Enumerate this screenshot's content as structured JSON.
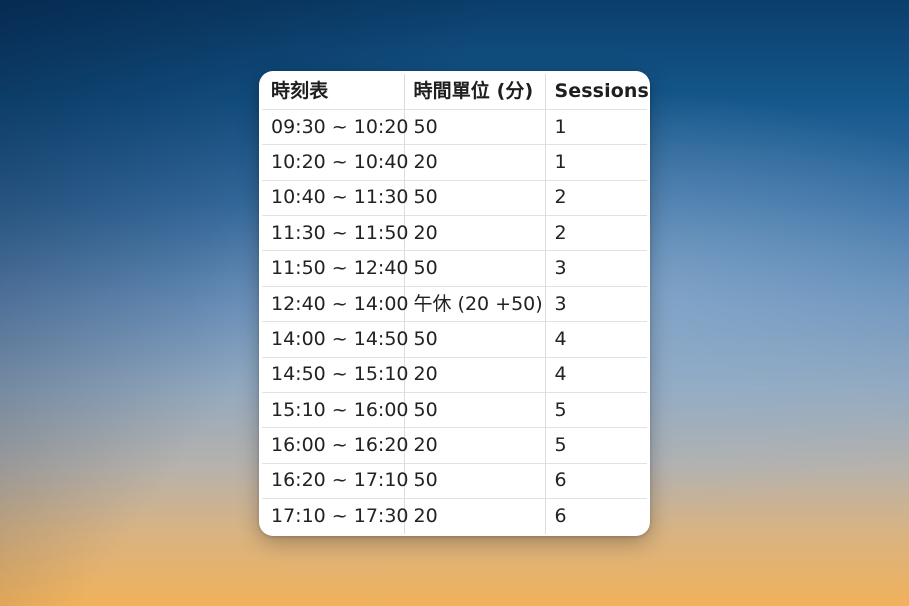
{
  "table": {
    "headers": [
      "時刻表",
      "時間單位 (分)",
      "Sessions"
    ],
    "rows": [
      [
        "09:30 ~ 10:20",
        "50",
        "1"
      ],
      [
        "10:20 ~ 10:40",
        "20",
        "1"
      ],
      [
        "10:40 ~ 11:30",
        "50",
        "2"
      ],
      [
        "11:30 ~ 11:50",
        "20",
        "2"
      ],
      [
        "11:50 ~ 12:40",
        "50",
        "3"
      ],
      [
        "12:40 ~ 14:00",
        "午休 (20 +50)",
        "3"
      ],
      [
        "14:00 ~ 14:50",
        "50",
        "4"
      ],
      [
        "14:50 ~ 15:10",
        "20",
        "4"
      ],
      [
        "15:10 ~ 16:00",
        "50",
        "5"
      ],
      [
        "16:00 ~ 16:20",
        "20",
        "5"
      ],
      [
        "16:20 ~ 17:10",
        "50",
        "6"
      ],
      [
        "17:10 ~ 17:30",
        "20",
        "6"
      ]
    ]
  }
}
